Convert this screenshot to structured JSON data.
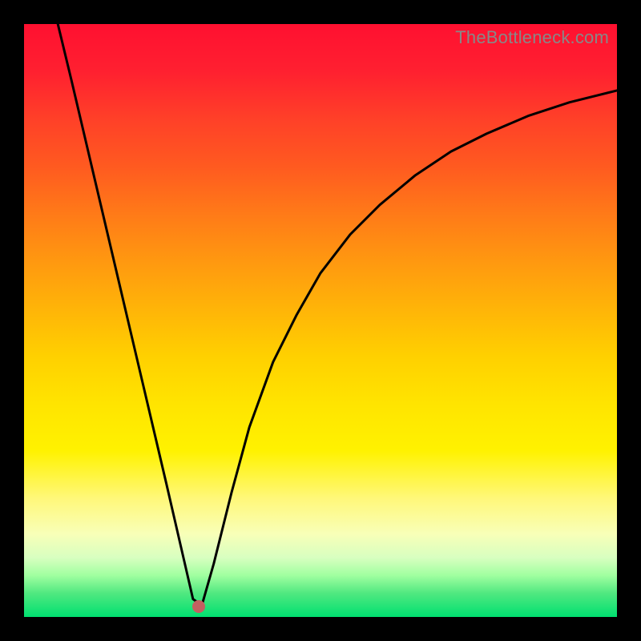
{
  "watermark": "TheBottleneck.com",
  "chart_data": {
    "type": "line",
    "title": "",
    "xlabel": "",
    "ylabel": "",
    "xlim": [
      0,
      1
    ],
    "ylim": [
      0,
      1
    ],
    "note": "Axis values are normalized 0–1 fractions of the plot area; no numeric tick labels are drawn. The y-axis encodes bottleneck severity (top=high/red, bottom=low/green). A single black curve descends steeply into a narrow minimum near x≈0.29 then rises asymptotically toward the upper-right. A red marker sits at the minimum.",
    "series": [
      {
        "name": "bottleneck-curve",
        "x": [
          0.057,
          0.08,
          0.1,
          0.12,
          0.14,
          0.16,
          0.18,
          0.2,
          0.22,
          0.24,
          0.255,
          0.27,
          0.285,
          0.3,
          0.32,
          0.35,
          0.38,
          0.42,
          0.46,
          0.5,
          0.55,
          0.6,
          0.66,
          0.72,
          0.78,
          0.85,
          0.92,
          1.0
        ],
        "y": [
          1.0,
          0.905,
          0.82,
          0.735,
          0.65,
          0.565,
          0.48,
          0.395,
          0.31,
          0.225,
          0.16,
          0.095,
          0.03,
          0.02,
          0.09,
          0.21,
          0.32,
          0.43,
          0.51,
          0.58,
          0.645,
          0.695,
          0.745,
          0.785,
          0.815,
          0.845,
          0.868,
          0.888
        ]
      }
    ],
    "marker": {
      "x": 0.295,
      "y": 0.017
    },
    "background_gradient": {
      "top": "#ff1030",
      "mid": "#ffd000",
      "bottom": "#00e070"
    }
  }
}
